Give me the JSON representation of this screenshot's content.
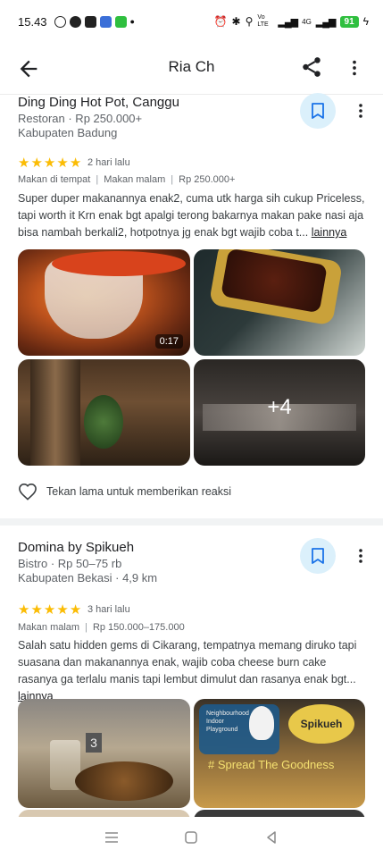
{
  "status_bar": {
    "time": "15.43",
    "network": "Vo LTE",
    "signal": "4G",
    "battery": "91"
  },
  "app_bar": {
    "title": "Ria Ch",
    "icons": [
      "back-arrow-icon",
      "share-icon",
      "more-vert-icon"
    ]
  },
  "reviews": [
    {
      "place_name": "Ding Ding Hot Pot, Canggu",
      "category_line": "Restoran · Rp 250.000+",
      "location_line": "Kabupaten Badung",
      "rating": 5,
      "date": "2 hari lalu",
      "tags": [
        "Makan di tempat",
        "Makan malam",
        "Rp 250.000+"
      ],
      "text": "Super duper makanannya enak2, cuma utk harga sih cukup Priceless, tapi worth it Krn enak bgt apalgi terong bakarnya makan pake nasi aja bisa nambah berkali2, hotpotnya jg enak bgt wajib coba t...",
      "more_label": "lainnya",
      "photos": [
        {
          "badge": "0:17"
        },
        {
          "badge": ""
        },
        {
          "badge": ""
        },
        {
          "badge": "+4"
        }
      ],
      "reaction_label": "Tekan lama untuk memberikan reaksi"
    },
    {
      "place_name": "Domina by Spikueh",
      "category_line": "Bistro · Rp 50–75 rb",
      "location_line": "Kabupaten Bekasi · 4,9 km",
      "rating": 5,
      "date": "3 hari lalu",
      "tags": [
        "Makan malam",
        "Rp 150.000–175.000"
      ],
      "text": "Salah satu hidden gems di Cikarang, tempatnya memang diruko tapi suasana dan makanannya enak, wajib coba cheese burn cake rasanya ga terlalu manis tapi lembut dimulut dan rasanya enak bgt...",
      "more_label": "lainnya",
      "photo_signage": [
        "Neighbourhood Indoor Playground",
        "Spikueh",
        "# Spread The Goodness"
      ],
      "photo_number": "3"
    }
  ],
  "colors": {
    "star": "#fbbc04",
    "save_button_bg": "#dbf0fb",
    "save_icon": "#1a73e8"
  }
}
